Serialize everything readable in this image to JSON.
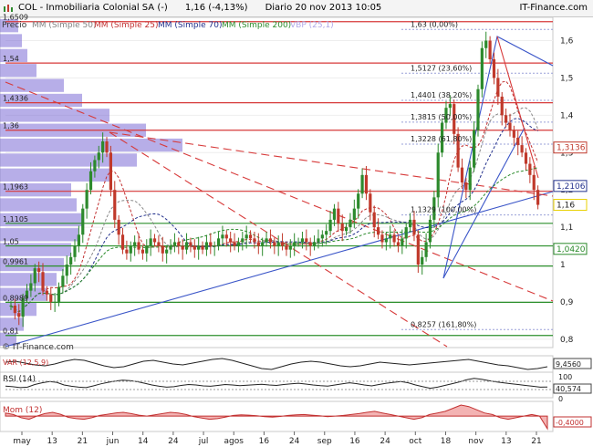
{
  "header": {
    "symbol": "COL",
    "name": "Inmobiliaria Colonial SA (-)",
    "last": "1,16",
    "change": "(-4,13%)",
    "period": "Diario",
    "datetime": "20 nov 2013 10:05",
    "site": "IT-Finance.com"
  },
  "legend": {
    "precio": "Precio",
    "mm50": "MM (Simple 50)",
    "mm25": "MM (Simple 25)",
    "mm70": "MM (Simple 70)",
    "mm200": "MM (Simple 200)",
    "vbp": "VBP (25,1)"
  },
  "watermark": "© IT-Finance.com",
  "colors": {
    "up": "#2d8a2d",
    "down": "#c0392b",
    "resistance": "#d73a3a",
    "support": "#2b8f2b",
    "trend_blue": "#3a55c8",
    "mm_red": "#c23030",
    "mm_navy": "#22308c",
    "mm_green": "#2a8a2a",
    "vbp": "#7b6cd6",
    "fib": "#9aa0d8"
  },
  "chart_data": [
    {
      "type": "candlestick",
      "title": "COL - Inmobiliaria Colonial SA (-) - Diario",
      "ylim": [
        0.78,
        1.66
      ],
      "y_ticks": [
        "0,8",
        "0,9",
        "1",
        "1,1",
        "1,2",
        "1,3",
        "1,4",
        "1,5",
        "1,6"
      ],
      "x_tick_labels": [
        "may",
        "13",
        "21",
        "jun",
        "14",
        "24",
        "jul",
        "agos",
        "16",
        "24",
        "sep",
        "16",
        "24",
        "oct",
        "18",
        "nov",
        "13",
        "21"
      ],
      "horizontal_levels": [
        {
          "label": "1,63 (0,00%)",
          "value": 1.63,
          "kind": "fib"
        },
        {
          "label": "1,5127 (23,60%)",
          "value": 1.5127,
          "kind": "fib"
        },
        {
          "label": "1,4401 (38,20%)",
          "value": 1.4401,
          "kind": "fib"
        },
        {
          "label": "1,3815 (50,00%)",
          "value": 1.3815,
          "kind": "fib"
        },
        {
          "label": "1,3228 (61,80%)",
          "value": 1.3228,
          "kind": "fib"
        },
        {
          "label": "1,1329 (100,00%)",
          "value": 1.1329,
          "kind": "fib"
        },
        {
          "label": "0,8257 (161,80%)",
          "value": 0.8257,
          "kind": "fib"
        },
        {
          "label": "1,54",
          "value": 1.54,
          "kind": "resistance"
        },
        {
          "label": "1,4336",
          "value": 1.4336,
          "kind": "resistance"
        },
        {
          "label": "1,36",
          "value": 1.36,
          "kind": "resistance"
        },
        {
          "label": "1,1963",
          "value": 1.1963,
          "kind": "resistance"
        },
        {
          "label": "1,1105",
          "value": 1.1105,
          "kind": "support"
        },
        {
          "label": "1,05",
          "value": 1.05,
          "kind": "support"
        },
        {
          "label": "0,9961",
          "value": 0.9961,
          "kind": "support"
        },
        {
          "label": "0,8989",
          "value": 0.8989,
          "kind": "support"
        },
        {
          "label": "0,81",
          "value": 0.81,
          "kind": "support"
        },
        {
          "label": "1,6509",
          "value": 1.6509,
          "kind": "resistance"
        }
      ],
      "right_badges": [
        {
          "label": "1,3136",
          "value": 1.3136,
          "color": "#c0392b"
        },
        {
          "label": "1,2106",
          "value": 1.2106,
          "color": "#22308c"
        },
        {
          "label": "1,16",
          "value": 1.16,
          "color": "#e8d000"
        },
        {
          "label": "1,0420",
          "value": 1.042,
          "color": "#2a8a2a"
        }
      ],
      "close_series": [
        0.89,
        0.87,
        0.86,
        0.91,
        0.93,
        0.95,
        0.99,
        0.98,
        0.93,
        0.92,
        0.9,
        0.9,
        0.94,
        0.97,
        1.0,
        1.02,
        1.05,
        1.08,
        1.15,
        1.2,
        1.25,
        1.28,
        1.3,
        1.33,
        1.3,
        1.2,
        1.12,
        1.08,
        1.04,
        1.03,
        1.05,
        1.06,
        1.04,
        1.03,
        1.05,
        1.07,
        1.06,
        1.05,
        1.03,
        1.04,
        1.05,
        1.06,
        1.05,
        1.04,
        1.06,
        1.05,
        1.04,
        1.05,
        1.04,
        1.06,
        1.05,
        1.05,
        1.07,
        1.08,
        1.07,
        1.06,
        1.05,
        1.06,
        1.07,
        1.08,
        1.07,
        1.06,
        1.05,
        1.06,
        1.07,
        1.06,
        1.05,
        1.06,
        1.05,
        1.04,
        1.05,
        1.06,
        1.06,
        1.07,
        1.06,
        1.05,
        1.06,
        1.07,
        1.08,
        1.09,
        1.12,
        1.15,
        1.11,
        1.09,
        1.1,
        1.12,
        1.15,
        1.19,
        1.24,
        1.19,
        1.14,
        1.1,
        1.08,
        1.06,
        1.07,
        1.08,
        1.06,
        1.05,
        1.07,
        1.1,
        1.12,
        1.08,
        1.0,
        1.02,
        1.06,
        1.12,
        1.18,
        1.3,
        1.38,
        1.42,
        1.43,
        1.35,
        1.26,
        1.22,
        1.2,
        1.26,
        1.36,
        1.47,
        1.58,
        1.6,
        1.55,
        1.5,
        1.45,
        1.4,
        1.38,
        1.36,
        1.34,
        1.32,
        1.3,
        1.27,
        1.24,
        1.2,
        1.16
      ]
    },
    {
      "type": "line",
      "title": "VAR",
      "legend_label": "VAR (12,5,9)",
      "value_label": "9,4560",
      "values": [
        0.2,
        0.3,
        0.1,
        -0.1,
        -0.2,
        0.0,
        0.3,
        0.5,
        0.4,
        0.1,
        -0.2,
        -0.4,
        -0.3,
        0.0,
        0.3,
        0.4,
        0.2,
        0.0,
        -0.1,
        0.1,
        0.3,
        0.5,
        0.6,
        0.4,
        0.1,
        -0.2,
        -0.5,
        -0.6,
        -0.3,
        0.0,
        0.2,
        0.3,
        0.2,
        0.0,
        -0.2,
        -0.3,
        -0.2,
        0.0,
        0.2,
        0.1,
        0.0,
        -0.1,
        0.0,
        0.1,
        0.2,
        0.3,
        0.4,
        0.5,
        0.3,
        0.1,
        -0.1,
        -0.2,
        -0.4,
        -0.6,
        -0.5,
        -0.3
      ]
    },
    {
      "type": "line",
      "title": "RSI (14)",
      "ylim": [
        0,
        100
      ],
      "y_ticks": [
        "100",
        "40,574",
        "0"
      ],
      "values": [
        45,
        42,
        38,
        40,
        52,
        60,
        66,
        62,
        50,
        44,
        40,
        38,
        46,
        55,
        62,
        68,
        72,
        70,
        65,
        58,
        50,
        44,
        40,
        42,
        48,
        52,
        50,
        46,
        44,
        48,
        52,
        50,
        47,
        49,
        51,
        53,
        50,
        48,
        52,
        55,
        58,
        54,
        50,
        47,
        45,
        50,
        55,
        60,
        56,
        50,
        46,
        52,
        58,
        62,
        66,
        60,
        50,
        42,
        35,
        40,
        48,
        56,
        64,
        74,
        80,
        76,
        70,
        64,
        60,
        56,
        52,
        48,
        44,
        40,
        41
      ]
    },
    {
      "type": "area",
      "title": "Mom (12)",
      "value_label": "-0,4000",
      "values": [
        0.1,
        0.05,
        -0.05,
        -0.1,
        0.0,
        0.08,
        0.12,
        0.06,
        -0.04,
        -0.08,
        -0.1,
        -0.05,
        0.02,
        0.06,
        0.1,
        0.12,
        0.08,
        0.03,
        0.0,
        0.04,
        0.08,
        0.12,
        0.1,
        0.05,
        -0.02,
        -0.06,
        -0.1,
        -0.08,
        -0.03,
        0.02,
        0.04,
        0.03,
        0.01,
        -0.02,
        -0.03,
        -0.01,
        0.02,
        0.04,
        0.05,
        0.03,
        0.01,
        -0.02,
        0.0,
        0.02,
        0.05,
        0.08,
        0.12,
        0.15,
        0.1,
        0.05,
        0.0,
        -0.05,
        -0.1,
        -0.05,
        0.05,
        0.1,
        0.15,
        0.25,
        0.35,
        0.3,
        0.2,
        0.1,
        0.05,
        -0.05,
        -0.1,
        -0.05,
        0.0,
        0.05,
        0.0,
        -0.4
      ]
    }
  ]
}
